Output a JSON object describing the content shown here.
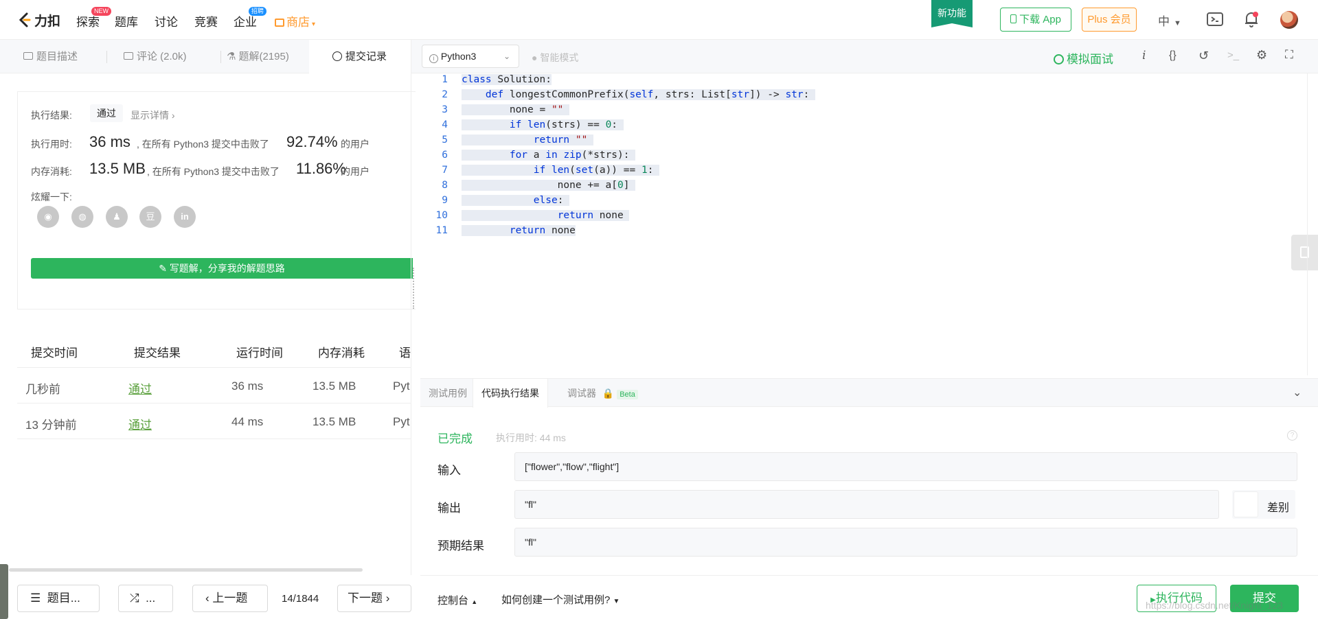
{
  "brand": {
    "logo_text": "力扣"
  },
  "nav": {
    "explore": "探索",
    "explore_badge": "NEW",
    "problems": "题库",
    "discuss": "讨论",
    "contest": "竞赛",
    "enterprise": "企业",
    "enterprise_badge": "招聘",
    "store": "商店",
    "new_feature": "新功能",
    "download_app": "下载 App",
    "plus": "Plus 会员",
    "lang": "中"
  },
  "left_tabs": [
    {
      "label": "题目描述"
    },
    {
      "label": "评论 (2.0k)"
    },
    {
      "label": "题解(2195)"
    },
    {
      "label": "提交记录"
    }
  ],
  "result": {
    "exec_result_label": "执行结果:",
    "status": "通过",
    "show_details": "显示详情",
    "time_label": "执行用时:",
    "time_value": "36 ms",
    "time_text": ", 在所有 Python3 提交中击败了",
    "time_percent": "92.74%",
    "users": "的用户",
    "mem_label": "内存消耗:",
    "mem_value": "13.5 MB",
    "mem_text": ", 在所有 Python3 提交中击败了",
    "mem_percent": "11.86%",
    "share_label": "炫耀一下:",
    "share_icons": [
      "wechat-icon",
      "weibo-icon",
      "qq-icon",
      "douban-icon",
      "linkedin-icon"
    ],
    "write_solution": "写题解，分享我的解题思路"
  },
  "submissions": {
    "headers": [
      "提交时间",
      "提交结果",
      "运行时间",
      "内存消耗",
      "语"
    ],
    "rows": [
      {
        "time": "几秒前",
        "result": "通过",
        "runtime": "36 ms",
        "memory": "13.5 MB",
        "lang": "Pyt"
      },
      {
        "time": "13 分钟前",
        "result": "通过",
        "runtime": "44 ms",
        "memory": "13.5 MB",
        "lang": "Pyt"
      }
    ]
  },
  "bottom_left": {
    "problems": "题目...",
    "random": "...",
    "prev": "上一题",
    "page": "14/1844",
    "next": "下一题"
  },
  "editor": {
    "language": "Python3",
    "smart_mode": "智能模式",
    "mock_interview": "模拟面试"
  },
  "code_lines": [
    "class Solution:",
    "    def longestCommonPrefix(self, strs: List[str]) -> str:",
    "        none = \"\"",
    "        if len(strs) == 0:",
    "            return \"\"",
    "        for a in zip(*strs):",
    "            if len(set(a)) == 1:",
    "                none += a[0]",
    "            else:",
    "                return none",
    "        return none"
  ],
  "console": {
    "tabs": [
      "测试用例",
      "代码执行结果",
      "调试器"
    ],
    "beta": "Beta",
    "done": "已完成",
    "exec_time": "执行用时: 44 ms",
    "input_label": "输入",
    "input_value": "[\"flower\",\"flow\",\"flight\"]",
    "output_label": "输出",
    "output_value": "\"fl\"",
    "diff_label": "差别",
    "expected_label": "预期结果",
    "expected_value": "\"fl\""
  },
  "bottom_right": {
    "console": "控制台",
    "howto": "如何创建一个测试用例?",
    "run": "执行代码",
    "submit": "提交",
    "watermark": "https://blog.csdn.net/Knight_123"
  },
  "colors": {
    "green": "#2db55d",
    "pass": "#5aa03c",
    "orange": "#ff9a2e",
    "blue_kw": "#0034d8"
  }
}
